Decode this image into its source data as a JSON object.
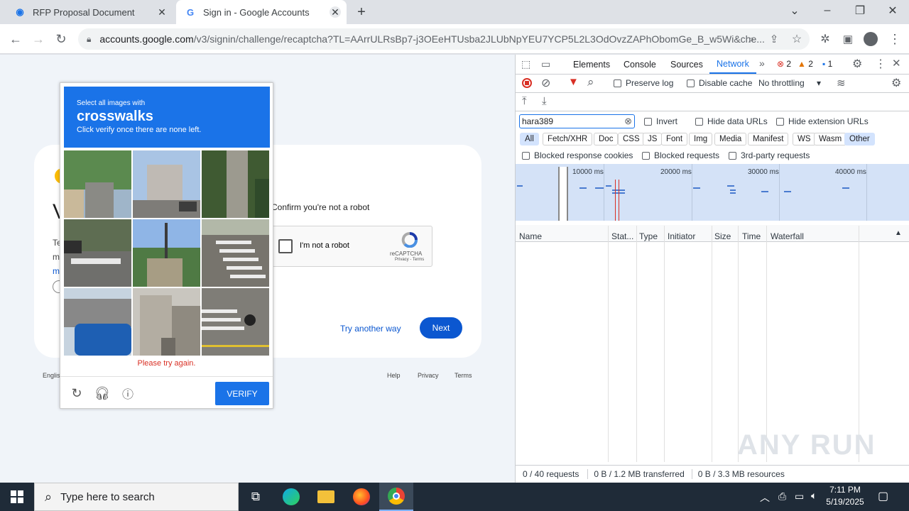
{
  "browser": {
    "tabs": [
      {
        "title": "RFP Proposal Document",
        "active": false
      },
      {
        "title": "Sign in - Google Accounts",
        "active": true
      }
    ],
    "url_host": "accounts.google.com",
    "url_path": "/v3/signin/challenge/recaptcha?TL=AArrULRsBp7-j3OEeHTUsba2JLUbNpYEU7YCP5L2L3OdOvzZAPhObomGe_B_w5Wi&che..."
  },
  "signin": {
    "confirm_text": "Confirm you're not a robot",
    "try_another": "Try another way",
    "next": "Next",
    "footer_lang": "Englis",
    "footer_links": [
      "Help",
      "Privacy",
      "Terms"
    ]
  },
  "recaptcha_widget": {
    "label": "I'm not a robot",
    "brand": "reCAPTCHA",
    "links": "Privacy - Terms"
  },
  "challenge": {
    "small": "Select all images with",
    "keyword": "crosswalks",
    "instruction": "Click verify once there are none left.",
    "error": "Please try again.",
    "verify": "VERIFY",
    "tiles": [
      "street-trees",
      "building-parking",
      "stone-stairs",
      "street-crosswalk",
      "trees-pole",
      "crosswalk-road",
      "bus-top",
      "alley-building",
      "crosswalk-motorbike"
    ]
  },
  "devtools": {
    "tabs": [
      "Elements",
      "Console",
      "Sources",
      "Network"
    ],
    "errors": "2",
    "warnings": "2",
    "messages": "1",
    "preserve_log": "Preserve log",
    "disable_cache": "Disable cache",
    "throttling": "No throttling",
    "filter_value": "hara389",
    "invert": "Invert",
    "hide_data_urls": "Hide data URLs",
    "hide_ext_urls": "Hide extension URLs",
    "filter_types": [
      "All",
      "Fetch/XHR",
      "Doc",
      "CSS",
      "JS",
      "Font",
      "Img",
      "Media",
      "Manifest",
      "WS",
      "Wasm",
      "Other"
    ],
    "blocked_cookies": "Blocked response cookies",
    "blocked_requests": "Blocked requests",
    "third_party": "3rd-party requests",
    "timeline_labels": [
      "10000 ms",
      "20000 ms",
      "30000 ms",
      "40000 ms"
    ],
    "columns": [
      "Name",
      "Stat...",
      "Type",
      "Initiator",
      "Size",
      "Time",
      "Waterfall"
    ],
    "status": {
      "requests": "0 / 40 requests",
      "transferred": "0 B / 1.2 MB transferred",
      "resources": "0 B / 3.3 MB resources"
    },
    "watermark": "ANY RUN"
  },
  "taskbar": {
    "search_placeholder": "Type here to search",
    "time": "7:11 PM",
    "date": "5/19/2025"
  },
  "colors": {
    "accent": "#1a73e8",
    "error": "#d93025",
    "taskbar": "#1f2b38"
  }
}
